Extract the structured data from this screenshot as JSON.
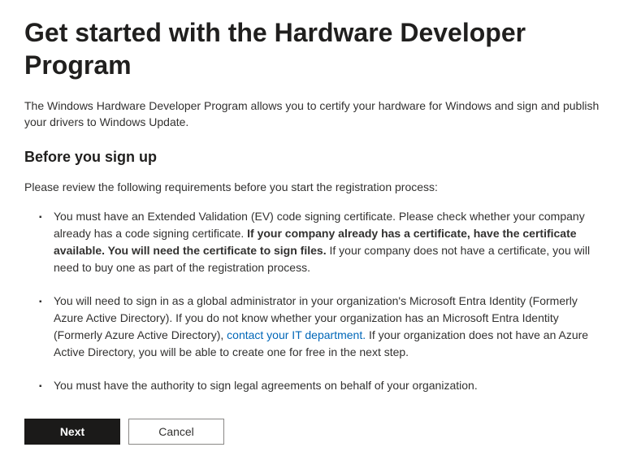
{
  "title": "Get started with the Hardware Developer Program",
  "intro": "The Windows Hardware Developer Program allows you to certify your hardware for Windows and sign and publish your drivers to Windows Update.",
  "subheading": "Before you sign up",
  "review_text": "Please review the following requirements before you start the registration process:",
  "requirements": {
    "item1": {
      "part1": "You must have an Extended Validation (EV) code signing certificate. Please check whether your company already has a code signing certificate. ",
      "bold": "If your company already has a certificate, have the certificate available. You will need the certificate to sign files.",
      "part2": " If your company does not have a certificate, you will need to buy one as part of the registration process."
    },
    "item2": {
      "part1": "You will need to sign in as a global administrator in your organization's Microsoft Entra Identity (Formerly Azure Active Directory). If you do not know whether your organization has an Microsoft Entra Identity (Formerly Azure Active Directory), ",
      "link": "contact your IT department.",
      "part2": " If your organization does not have an Azure Active Directory, you will be able to create one for free in the next step."
    },
    "item3": "You must have the authority to sign legal agreements on behalf of your organization."
  },
  "buttons": {
    "next": "Next",
    "cancel": "Cancel"
  }
}
